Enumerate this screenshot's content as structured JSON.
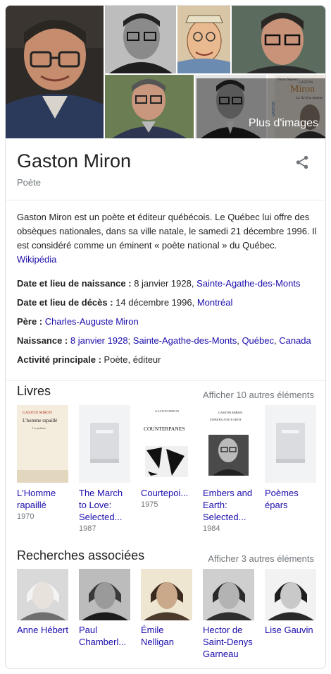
{
  "images": {
    "more_label": "Plus d'images",
    "book_cover_text": {
      "author": "Pierre Nepveu",
      "subject": "GASTON",
      "surname": "Miron",
      "subtitle": "La vie d'un homme",
      "spine": "GASTON"
    }
  },
  "header": {
    "title": "Gaston Miron",
    "subtitle": "Poète",
    "share_icon": "share-icon"
  },
  "description": {
    "text": "Gaston Miron est un poète et éditeur québécois. Le Québec lui offre des obsèques nationales, dans sa ville natale, le samedi 21 décembre 1996. Il est considéré comme un éminent « poète national » du Québec.",
    "source": "Wikipédia"
  },
  "facts": [
    {
      "key": "Date et lieu de naissance : ",
      "parts": [
        {
          "text": "8 janvier 1928, "
        },
        {
          "text": "Sainte-Agathe-des-Monts",
          "link": true
        }
      ]
    },
    {
      "key": "Date et lieu de décès : ",
      "parts": [
        {
          "text": "14 décembre 1996, "
        },
        {
          "text": "Montréal",
          "link": true
        }
      ]
    },
    {
      "key": "Père : ",
      "parts": [
        {
          "text": "Charles-Auguste Miron",
          "link": true
        }
      ]
    },
    {
      "key": "Naissance : ",
      "parts": [
        {
          "text": "8 janvier 1928",
          "link": true
        },
        {
          "text": "; "
        },
        {
          "text": "Sainte-Agathe-des-Monts",
          "link": true
        },
        {
          "text": ", "
        },
        {
          "text": "Québec",
          "link": true
        },
        {
          "text": ", "
        },
        {
          "text": "Canada",
          "link": true
        }
      ]
    },
    {
      "key": "Activité principale : ",
      "parts": [
        {
          "text": "Poète, éditeur"
        }
      ]
    }
  ],
  "books": {
    "title": "Livres",
    "more": "Afficher 10 autres éléments",
    "items": [
      {
        "label": "L'Homme rapaillé",
        "year": "1970",
        "cover": "homme",
        "cover_author": "GASTON MIRON",
        "cover_title": "L'homme rapaillé",
        "cover_sub": "Les poèmes"
      },
      {
        "label": "The March to Love: Selected...",
        "year": "1987",
        "cover": "placeholder"
      },
      {
        "label": "Courtepoi...",
        "year": "1975",
        "cover": "counterpanes",
        "cover_author": "GASTON MIRON",
        "cover_title": "COUNTERPANES"
      },
      {
        "label": "Embers and Earth: Selected...",
        "year": "1984",
        "cover": "embers",
        "cover_author": "GASTON MIRON",
        "cover_title": "EMBERS AND EARTH"
      },
      {
        "label": "Poèmes épars",
        "year": "",
        "cover": "placeholder"
      }
    ]
  },
  "related": {
    "title": "Recherches associées",
    "more": "Afficher 3 autres éléments",
    "items": [
      {
        "label": "Anne Hébert",
        "photo": "anne"
      },
      {
        "label": "Paul Chamberl...",
        "photo": "paul"
      },
      {
        "label": "Émile Nelligan",
        "photo": "emile"
      },
      {
        "label": "Hector de Saint-Denys Garneau",
        "photo": "hector"
      },
      {
        "label": "Lise Gauvin",
        "photo": "lise"
      }
    ]
  }
}
